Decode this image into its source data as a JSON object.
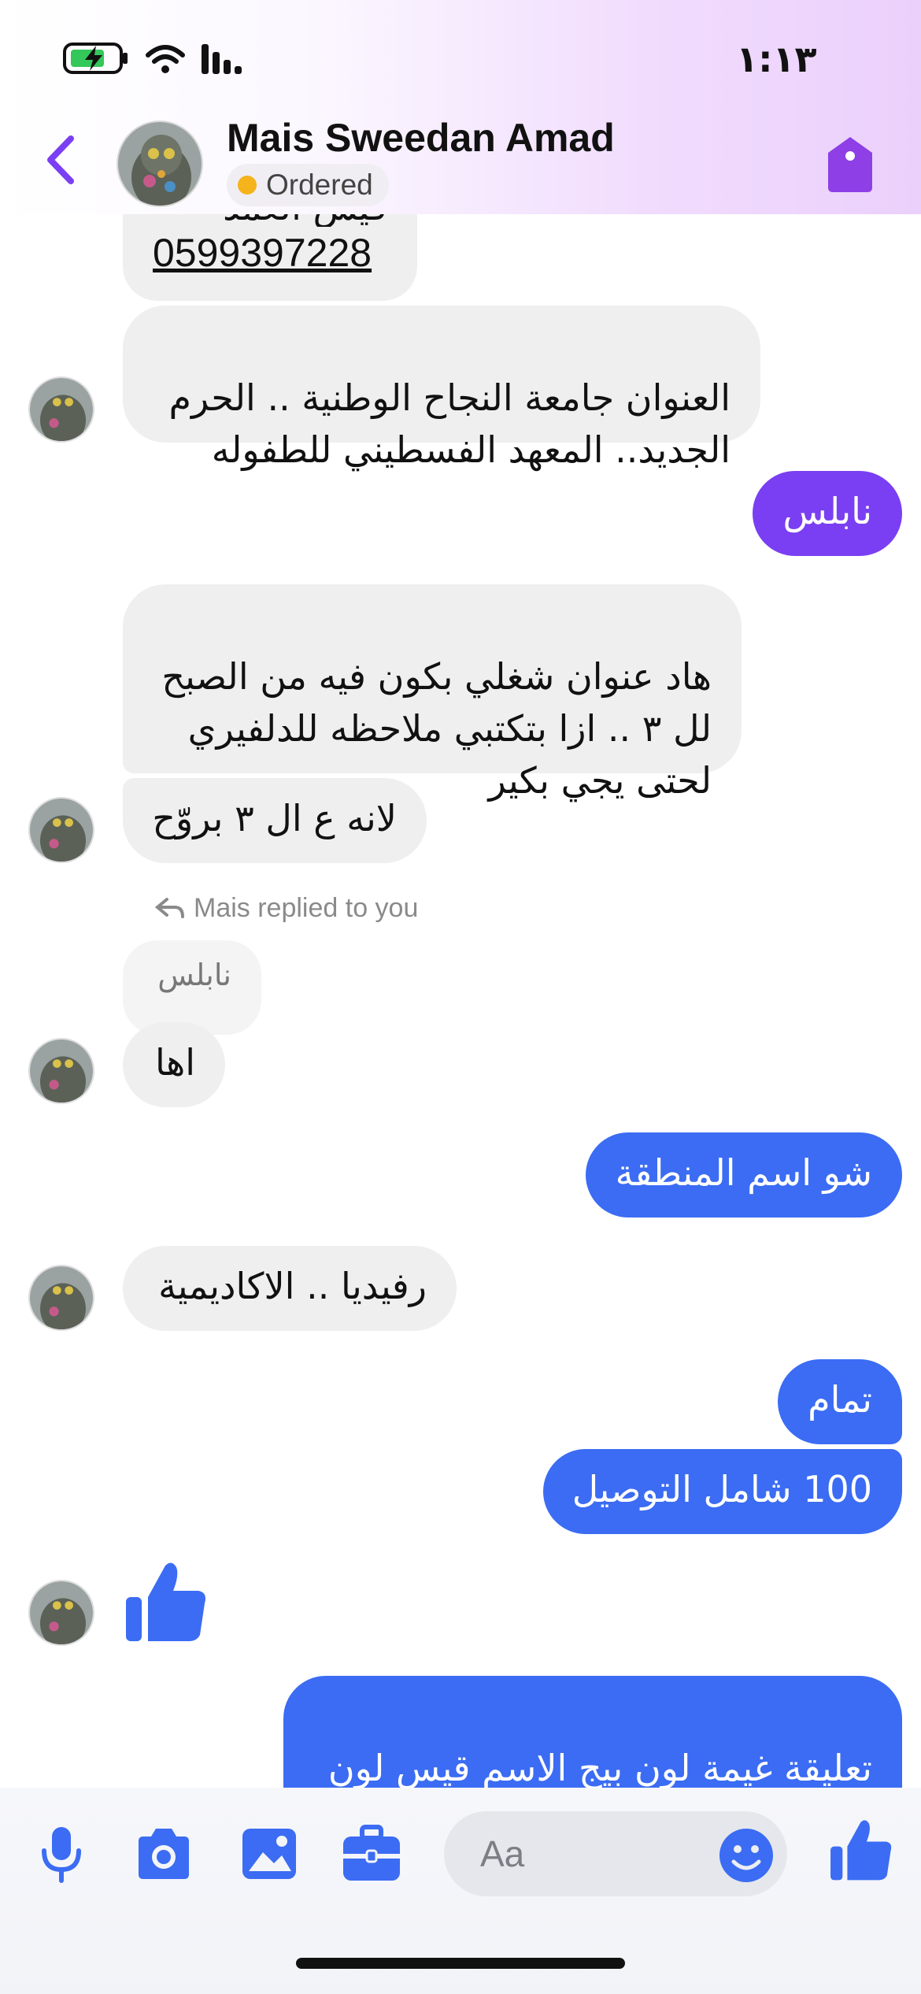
{
  "status_bar": {
    "time": "١:١٣"
  },
  "header": {
    "contact_name": "Mais Sweedan Amad",
    "order_status": "Ordered",
    "colors": {
      "accent": "#7a3ff2",
      "status_dot": "#f5b31c"
    }
  },
  "messages": [
    {
      "side": "in",
      "text": "قيس العمد",
      "phone": "0599397228"
    },
    {
      "side": "in",
      "text": "العنوان جامعة النجاح الوطنية .. الحرم\nالجديد.. المعهد الفسطيني للطفوله"
    },
    {
      "side": "out",
      "text": "نابلس"
    },
    {
      "side": "in",
      "text": "هاد عنوان شغلي بكون فيه من الصبح\nلل ٣ .. ازا بتكتبي ملاحظه للدلفيري\nلحتى يجي بكير"
    },
    {
      "side": "in",
      "text": "لانه ع ال ٣ بروّح"
    },
    {
      "side": "reply_label",
      "text": "Mais replied to you"
    },
    {
      "side": "quote",
      "text": "نابلس"
    },
    {
      "side": "in",
      "text": "اها"
    },
    {
      "side": "out",
      "text": "شو اسم المنطقة"
    },
    {
      "side": "in",
      "text": "رفيديا .. الاكاديمية"
    },
    {
      "side": "out",
      "text": "تمام"
    },
    {
      "side": "out",
      "text": "100 شامل التوصيل"
    },
    {
      "side": "in",
      "text": "thumbs-up-icon"
    },
    {
      "side": "out",
      "text": "تعليقة غيمة لون بيج الاسم قيس لون\nالاسم دهبي مع الاشكال"
    }
  ],
  "composer": {
    "placeholder": "Aa",
    "icons": [
      "microphone-icon",
      "camera-icon",
      "image-icon",
      "briefcase-icon",
      "emoji-icon",
      "thumbs-up-icon"
    ],
    "accent": "#3b6cf3"
  }
}
